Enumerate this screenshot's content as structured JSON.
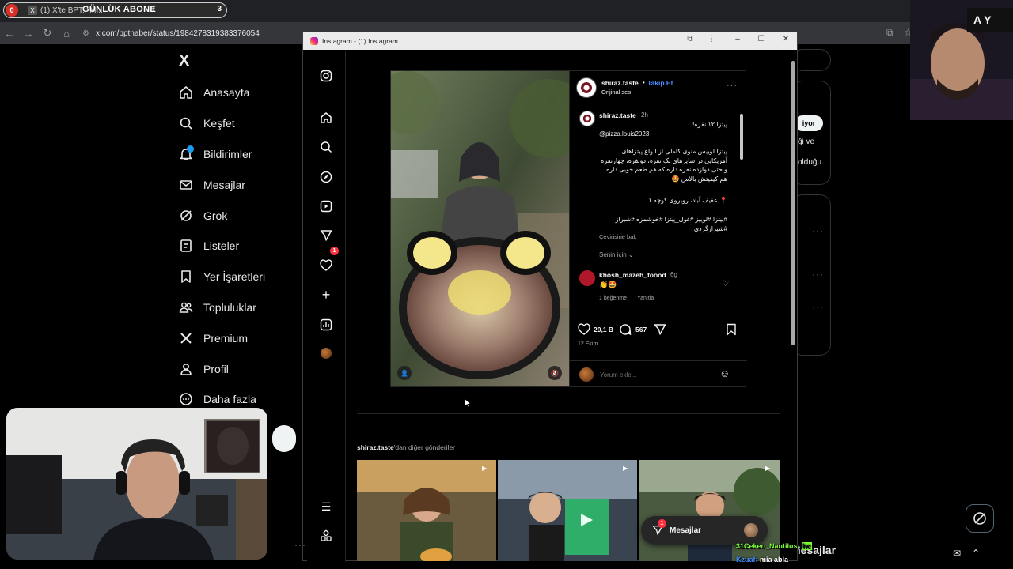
{
  "browser": {
    "tab_rec_badge": "0",
    "tab_title": "(1) X'te BPT: \"M...",
    "tab_count": "3",
    "overlay_title": "GÜNLÜK ABONE",
    "url": "x.com/bpthaber/status/1984278319383376054"
  },
  "x_sidebar": {
    "logo": "X",
    "items": [
      {
        "label": "Anasayfa",
        "icon": "home-icon"
      },
      {
        "label": "Keşfet",
        "icon": "search-icon"
      },
      {
        "label": "Bildirimler",
        "icon": "bell-icon"
      },
      {
        "label": "Mesajlar",
        "icon": "mail-icon"
      },
      {
        "label": "Grok",
        "icon": "grok-icon"
      },
      {
        "label": "Listeler",
        "icon": "list-icon"
      },
      {
        "label": "Yer İşaretleri",
        "icon": "bookmark-icon"
      },
      {
        "label": "Topluluklar",
        "icon": "people-icon"
      },
      {
        "label": "Premium",
        "icon": "x-premium-icon"
      },
      {
        "label": "Profil",
        "icon": "person-icon"
      },
      {
        "label": "Daha fazla",
        "icon": "more-circle-icon"
      }
    ]
  },
  "x_right": {
    "follow_label": "iyor",
    "frag_line1": "ği ve",
    "frag_line2": "olduğu",
    "dock_label": "Mesajlar"
  },
  "instagram": {
    "window_title": "Instagram - (1) Instagram",
    "notification_count": "1",
    "post": {
      "username": "shiraz.taste",
      "separator": "•",
      "follow": "Takip Et",
      "audio": "Orijinal ses",
      "caption_user": "shiraz.taste",
      "caption_time": "2h",
      "caption_line1": "پیتزا ۱۲ نفره!",
      "caption_mention": "@pizza.louis2023",
      "caption_body": "پیتزا لوییس منوی کاملی از انواع پیتزاهای آمریکایی در سایزهای تک نفره، دونفره، چهارنفره و حتی دوازده نفره داره که هم طعم خوبی داره هم کیفیتش بالاس 🤩",
      "caption_location": "📍 عفیف آباد، روبروی کوچه ۱",
      "caption_tags": "#پیتزا #لوییز #غول_پیتزا #خوشمزه #شیراز #شیرازگردی",
      "translate": "Çevirisine bak",
      "for_you": "Senin için",
      "comment_user": "khosh_mazeh_foood",
      "comment_time": "6g",
      "comment_text": "👏🤩",
      "comment_likes": "1 beğenme",
      "comment_reply": "Yanıtla",
      "likes": "20,1 B",
      "comments": "567",
      "date": "12 Ekim",
      "comment_placeholder": "Yorum ekle..."
    },
    "more_posts_user": "shiraz.taste",
    "more_posts_suffix": "'dan diğer gönderiler",
    "messages_pill": "Mesajlar",
    "messages_badge": "1"
  },
  "chat": {
    "line1_user": "31Ceken_Nautilus:",
    "line1_emote": "hc",
    "line2_user": "Kzuaf:",
    "line2_text": "mia abla"
  }
}
